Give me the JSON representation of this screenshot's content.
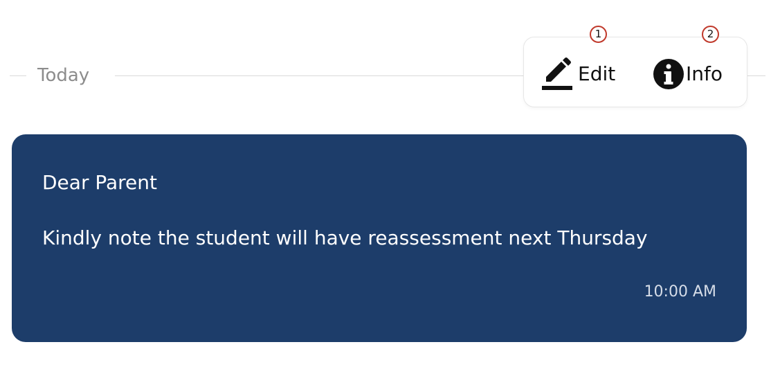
{
  "divider": {
    "label": "Today"
  },
  "toolbar": {
    "edit_label": "Edit",
    "info_label": "Info",
    "edit_icon": "pencil-icon",
    "info_icon": "info-icon"
  },
  "markers": {
    "first": "1",
    "second": "2"
  },
  "message": {
    "greeting": "Dear Parent",
    "body": "Kindly note the student will have reassessment next Thursday",
    "time": "10:00 AM"
  },
  "colors": {
    "bubble": "#1d3d6a",
    "marker_ring": "#c0392b",
    "divider_text": "#8c8c8c"
  }
}
